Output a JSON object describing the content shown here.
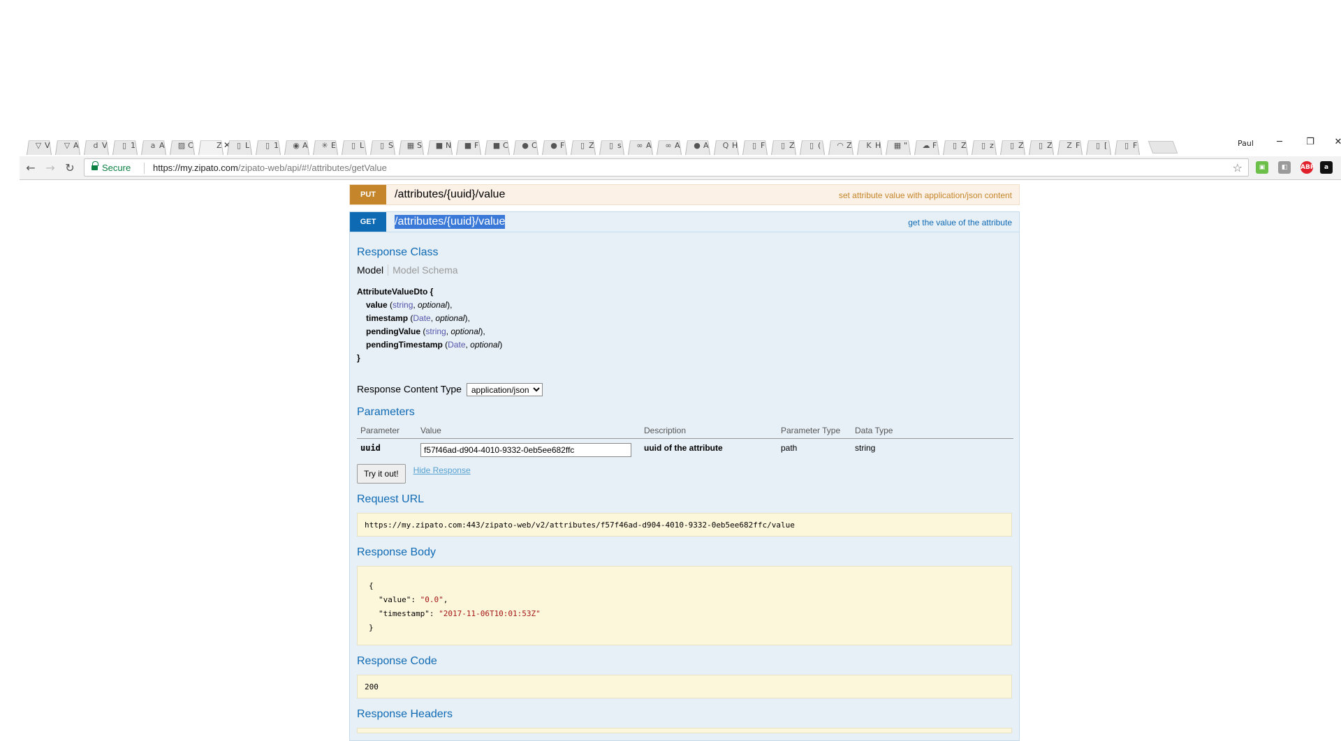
{
  "browser": {
    "tab_count": 42,
    "tabs": [
      {
        "icon": "vivaldi-icon",
        "glyph": "▽",
        "letter": "V"
      },
      {
        "icon": "vivaldi-icon",
        "glyph": "▽",
        "letter": "A"
      },
      {
        "icon": "d-icon",
        "glyph": "d",
        "letter": "V"
      },
      {
        "icon": "page-icon",
        "glyph": "▯",
        "letter": "1"
      },
      {
        "icon": "amazon-icon",
        "glyph": "a",
        "letter": "A"
      },
      {
        "icon": "image-icon",
        "glyph": "▨",
        "letter": "C"
      },
      {
        "icon": "zipato-icon",
        "glyph": "",
        "letter": "Z",
        "active": true
      },
      {
        "icon": "page-icon",
        "glyph": "▯",
        "letter": "L"
      },
      {
        "icon": "page-icon",
        "glyph": "▯",
        "letter": "1"
      },
      {
        "icon": "eye-icon",
        "glyph": "◉",
        "letter": "A"
      },
      {
        "icon": "gear-icon",
        "glyph": "✳",
        "letter": "E"
      },
      {
        "icon": "page-icon",
        "glyph": "▯",
        "letter": "L"
      },
      {
        "icon": "page-icon",
        "glyph": "▯",
        "letter": "S"
      },
      {
        "icon": "store-icon",
        "glyph": "▦",
        "letter": "S"
      },
      {
        "icon": "terminal-icon",
        "glyph": "■",
        "letter": "N"
      },
      {
        "icon": "terminal-icon",
        "glyph": "■",
        "letter": "F"
      },
      {
        "icon": "terminal-icon",
        "glyph": "■",
        "letter": "C"
      },
      {
        "icon": "github-icon",
        "glyph": "●",
        "letter": "C"
      },
      {
        "icon": "github-icon",
        "glyph": "●",
        "letter": "F"
      },
      {
        "icon": "page-icon",
        "glyph": "▯",
        "letter": "Z"
      },
      {
        "icon": "page-icon",
        "glyph": "▯",
        "letter": "s"
      },
      {
        "icon": "arduino-icon",
        "glyph": "∞",
        "letter": "A"
      },
      {
        "icon": "arduino-icon",
        "glyph": "∞",
        "letter": "A"
      },
      {
        "icon": "github-icon",
        "glyph": "●",
        "letter": "A"
      },
      {
        "icon": "quora-icon",
        "glyph": "Q",
        "letter": "H"
      },
      {
        "icon": "page-icon",
        "glyph": "▯",
        "letter": "F"
      },
      {
        "icon": "page-icon",
        "glyph": "▯",
        "letter": "Z"
      },
      {
        "icon": "page-icon",
        "glyph": "▯",
        "letter": "("
      },
      {
        "icon": "wifi-icon",
        "glyph": "◠",
        "letter": "Z"
      },
      {
        "icon": "k-icon",
        "glyph": "K",
        "letter": "H"
      },
      {
        "icon": "store-icon",
        "glyph": "▦",
        "letter": "\""
      },
      {
        "icon": "cloud-icon",
        "glyph": "☁",
        "letter": "F"
      },
      {
        "icon": "page-icon",
        "glyph": "▯",
        "letter": "Z"
      },
      {
        "icon": "page-icon",
        "glyph": "▯",
        "letter": "z"
      },
      {
        "icon": "page-icon",
        "glyph": "▯",
        "letter": "Z"
      },
      {
        "icon": "page-icon",
        "glyph": "▯",
        "letter": "Z"
      },
      {
        "icon": "zipato-icon",
        "glyph": "Z",
        "letter": "F"
      },
      {
        "icon": "page-icon",
        "glyph": "▯",
        "letter": "["
      },
      {
        "icon": "page-icon",
        "glyph": "▯",
        "letter": "F"
      }
    ],
    "profile_name": "Paul",
    "secure_label": "Secure",
    "url_host": "https://my.zipato.com",
    "url_path": "/zipato-web/api/#!/attributes/getValue",
    "extensions": [
      "feedly-icon",
      "extension-icon",
      "adblock-icon",
      "amazon-assistant-icon"
    ]
  },
  "operations": {
    "put": {
      "method": "PUT",
      "path": "/attributes/{uuid}/value",
      "summary": "set attribute value with application/json content"
    },
    "get": {
      "method": "GET",
      "path": "/attributes/{uuid}/value",
      "summary": "get the value of the attribute"
    }
  },
  "response_class": {
    "title": "Response Class",
    "tab_model": "Model",
    "tab_schema": "Model Schema",
    "model_name": "AttributeValueDto {",
    "props": [
      {
        "name": "value",
        "type": "string",
        "opt": "optional"
      },
      {
        "name": "timestamp",
        "type": "Date",
        "opt": "optional"
      },
      {
        "name": "pendingValue",
        "type": "string",
        "opt": "optional"
      },
      {
        "name": "pendingTimestamp",
        "type": "Date",
        "opt": "optional"
      }
    ],
    "close": "}"
  },
  "content_type": {
    "label": "Response Content Type",
    "selected": "application/json"
  },
  "parameters": {
    "title": "Parameters",
    "headers": {
      "param": "Parameter",
      "value": "Value",
      "desc": "Description",
      "ptype": "Parameter Type",
      "dtype": "Data Type"
    },
    "row": {
      "name": "uuid",
      "value": "f57f46ad-d904-4010-9332-0eb5ee682ffc",
      "desc": "uuid of the attribute",
      "ptype": "path",
      "dtype": "string"
    }
  },
  "actions": {
    "try_label": "Try it out!",
    "hide_label": "Hide Response"
  },
  "request_url": {
    "title": "Request URL",
    "value": "https://my.zipato.com:443/zipato-web/v2/attributes/f57f46ad-d904-4010-9332-0eb5ee682ffc/value"
  },
  "response_body": {
    "title": "Response Body",
    "open": "{",
    "value_key": "\"value\": ",
    "value_val": "\"0.0\"",
    "ts_key": "\"timestamp\": ",
    "ts_val": "\"2017-11-06T10:01:53Z\"",
    "close": "}"
  },
  "response_code": {
    "title": "Response Code",
    "value": "200"
  },
  "response_headers": {
    "title": "Response Headers"
  }
}
